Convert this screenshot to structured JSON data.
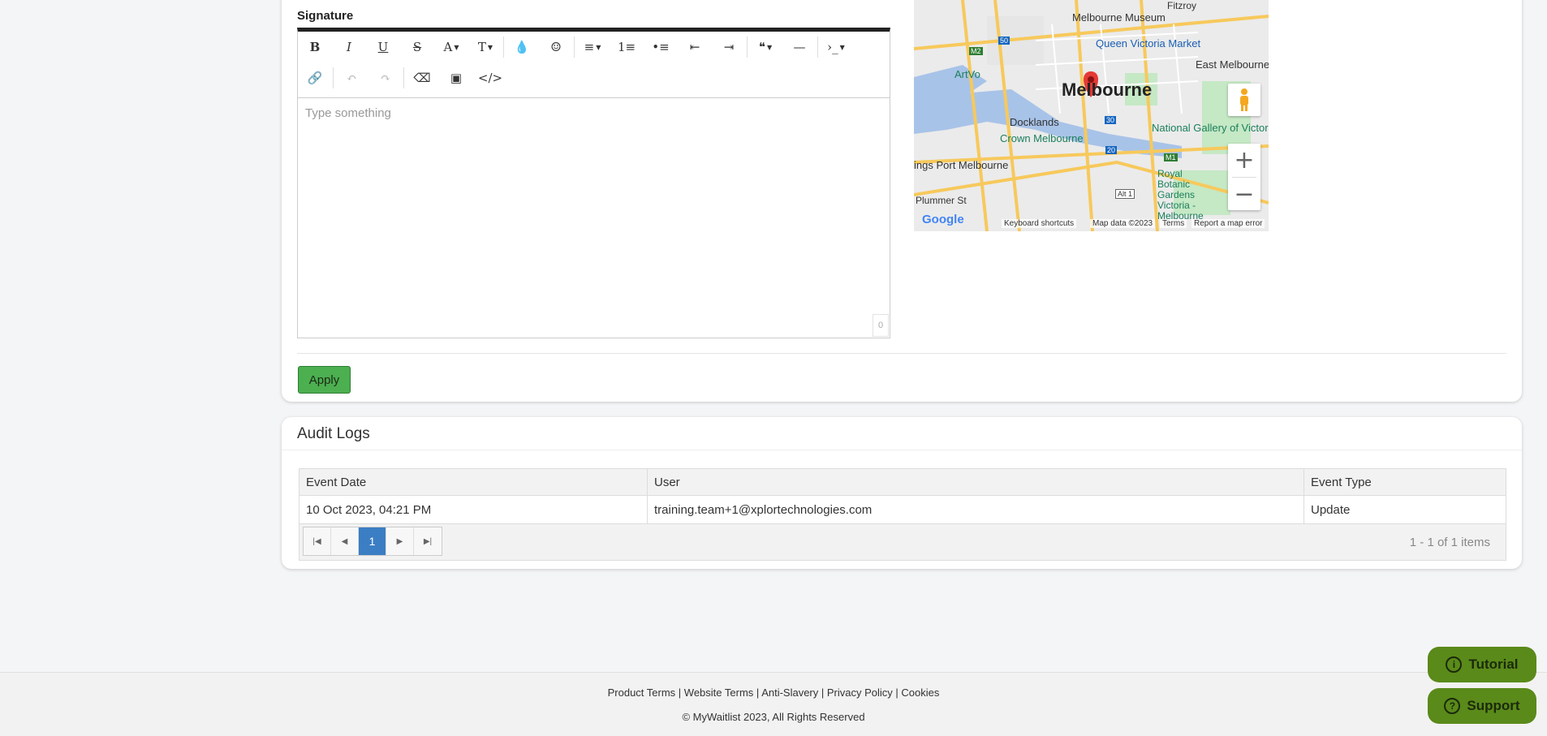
{
  "signature": {
    "label": "Signature",
    "placeholder": "Type something",
    "char_count": "0"
  },
  "toolbar": {
    "row1": [
      {
        "name": "bold-button",
        "glyph": "B",
        "icon": "bold-icon"
      },
      {
        "name": "italic-button",
        "glyph": "I",
        "icon": "italic-icon"
      },
      {
        "name": "underline-button",
        "glyph": "U",
        "icon": "underline-icon"
      },
      {
        "name": "strikethrough-button",
        "glyph": "S",
        "icon": "strikethrough-icon"
      },
      {
        "name": "font-button",
        "glyph": "A",
        "icon": "font-icon"
      },
      {
        "name": "font-size-button",
        "glyph": "T",
        "icon": "font-size-icon"
      },
      {
        "name": "color-button",
        "glyph": "💧",
        "icon": "droplet-icon"
      },
      {
        "name": "emoji-button",
        "glyph": "☺",
        "icon": "smiley-icon"
      },
      {
        "name": "align-button",
        "glyph": "≡",
        "icon": "align-icon"
      },
      {
        "name": "ordered-list-button",
        "glyph": "1≡",
        "icon": "ordered-list-icon"
      },
      {
        "name": "unordered-list-button",
        "glyph": "•≡",
        "icon": "unordered-list-icon"
      },
      {
        "name": "outdent-button",
        "glyph": "⇤",
        "icon": "outdent-icon"
      },
      {
        "name": "indent-button",
        "glyph": "⇥",
        "icon": "indent-icon"
      },
      {
        "name": "quote-button",
        "glyph": "❝",
        "icon": "quote-icon"
      },
      {
        "name": "horizontal-rule-button",
        "glyph": "—",
        "icon": "horizontal-rule-icon"
      },
      {
        "name": "code-block-button",
        "glyph": "›_",
        "icon": "terminal-icon"
      }
    ],
    "row2": [
      {
        "name": "link-button",
        "glyph": "🔗",
        "icon": "link-icon"
      },
      {
        "name": "undo-button",
        "glyph": "↶",
        "icon": "undo-icon"
      },
      {
        "name": "redo-button",
        "glyph": "↷",
        "icon": "redo-icon"
      },
      {
        "name": "clear-format-button",
        "glyph": "⌫",
        "icon": "eraser-icon"
      },
      {
        "name": "image-button",
        "glyph": "▣",
        "icon": "image-icon"
      },
      {
        "name": "html-button",
        "glyph": "</>",
        "icon": "code-icon"
      }
    ]
  },
  "map": {
    "labels": [
      "Melbourne Museum",
      "Queen Victoria Market",
      "East Melbourne",
      "Melbourne",
      "Docklands",
      "National Gallery of Victoria",
      "Crown Melbourne",
      "ArtVo",
      "ings Port Melbourne",
      "Royal Botanic Gardens Victoria - Melbourne",
      "Plummer St",
      "Fitzroy"
    ],
    "road_badges": [
      "M2",
      "50",
      "30",
      "20",
      "M1",
      "Alt 1"
    ],
    "footer": {
      "shortcuts": "Keyboard shortcuts",
      "data": "Map data ©2023",
      "terms": "Terms",
      "report": "Report a map error"
    },
    "brand": "Google",
    "zoom_in": "+",
    "zoom_out": "−",
    "colors": {
      "water": "#a8c3e8",
      "park": "#c5e8c5",
      "road": "#f7c95c",
      "pin": "#e53935"
    }
  },
  "apply_label": "Apply",
  "audit": {
    "title": "Audit Logs",
    "columns": [
      "Event Date",
      "User",
      "Event Type"
    ],
    "rows": [
      [
        "10 Oct 2023, 04:21 PM",
        "training.team+1@xplortechnologies.com",
        "Update"
      ]
    ],
    "pager": {
      "current": "1",
      "info": "1 - 1 of 1 items"
    }
  },
  "footer": {
    "links": [
      "Product Terms",
      "Website Terms",
      "Anti-Slavery",
      "Privacy Policy",
      "Cookies"
    ],
    "copyright": "© MyWaitlist 2023, All Rights Reserved"
  },
  "help": {
    "tutorial": "Tutorial",
    "support": "Support"
  }
}
